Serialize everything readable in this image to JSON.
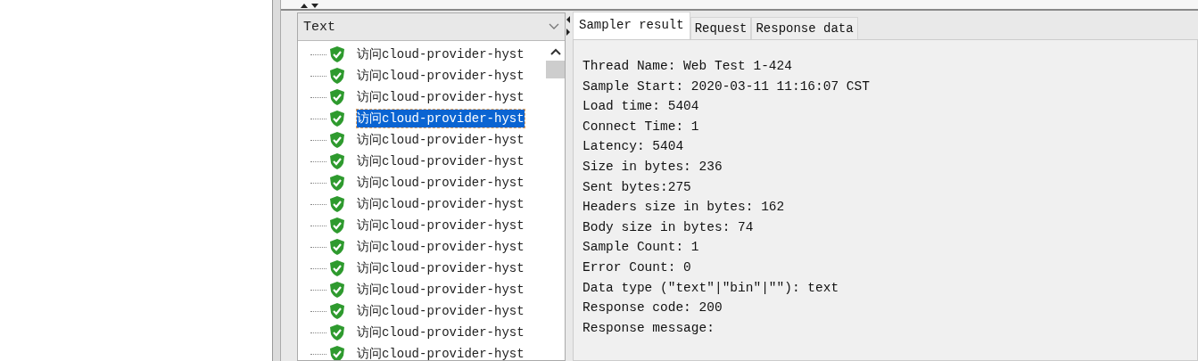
{
  "results_tree": {
    "renderer": "Text",
    "items": [
      {
        "label": "访问cloud-provider-hyst",
        "selected": false,
        "success": true
      },
      {
        "label": "访问cloud-provider-hyst",
        "selected": false,
        "success": true
      },
      {
        "label": "访问cloud-provider-hyst",
        "selected": false,
        "success": true
      },
      {
        "label": "访问cloud-provider-hyst",
        "selected": true,
        "success": true
      },
      {
        "label": "访问cloud-provider-hyst",
        "selected": false,
        "success": true
      },
      {
        "label": "访问cloud-provider-hyst",
        "selected": false,
        "success": true
      },
      {
        "label": "访问cloud-provider-hyst",
        "selected": false,
        "success": true
      },
      {
        "label": "访问cloud-provider-hyst",
        "selected": false,
        "success": true
      },
      {
        "label": "访问cloud-provider-hyst",
        "selected": false,
        "success": true
      },
      {
        "label": "访问cloud-provider-hyst",
        "selected": false,
        "success": true
      },
      {
        "label": "访问cloud-provider-hyst",
        "selected": false,
        "success": true
      },
      {
        "label": "访问cloud-provider-hyst",
        "selected": false,
        "success": true
      },
      {
        "label": "访问cloud-provider-hyst",
        "selected": false,
        "success": true
      },
      {
        "label": "访问cloud-provider-hyst",
        "selected": false,
        "success": true
      },
      {
        "label": "访问cloud-provider-hyst",
        "selected": false,
        "success": true
      }
    ]
  },
  "tabs": [
    {
      "label": "Sampler result",
      "selected": true
    },
    {
      "label": "Request",
      "selected": false
    },
    {
      "label": "Response data",
      "selected": false
    }
  ],
  "sampler_result": [
    "Thread Name: Web Test 1-424",
    "Sample Start: 2020-03-11 11:16:07 CST",
    "Load time: 5404",
    "Connect Time: 1",
    "Latency: 5404",
    "Size in bytes: 236",
    "Sent bytes:275",
    "Headers size in bytes: 162",
    "Body size in bytes: 74",
    "Sample Count: 1",
    "Error Count: 0",
    "Data type (\"text\"|\"bin\"|\"\"): text",
    "Response code: 200",
    "Response message:"
  ]
}
